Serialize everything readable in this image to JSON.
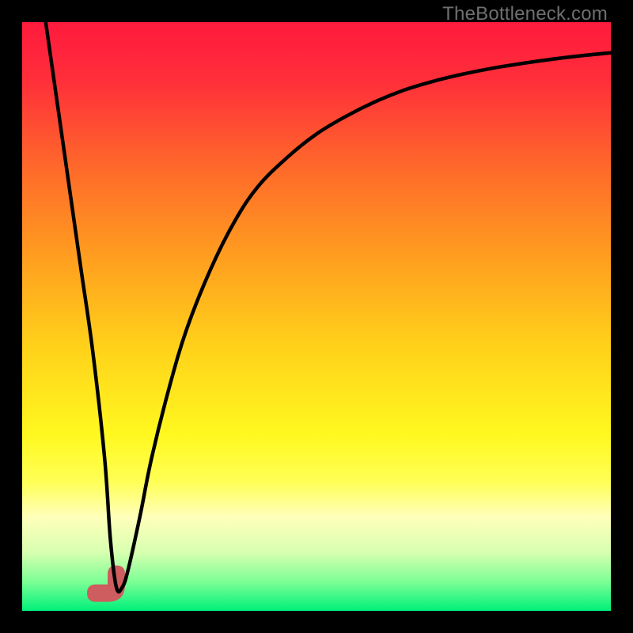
{
  "watermark": {
    "text": "TheBottleneck.com"
  },
  "colors": {
    "frame": "#000000",
    "watermark": "#6f6f6f",
    "curve": "#000000",
    "blob": "#cd5d5e",
    "gradient_stops": [
      {
        "offset": 0.0,
        "color": "#ff1a3d"
      },
      {
        "offset": 0.1,
        "color": "#ff2f3a"
      },
      {
        "offset": 0.25,
        "color": "#ff6a2a"
      },
      {
        "offset": 0.4,
        "color": "#ff9e1f"
      },
      {
        "offset": 0.55,
        "color": "#ffd11a"
      },
      {
        "offset": 0.7,
        "color": "#fff81f"
      },
      {
        "offset": 0.78,
        "color": "#ffff55"
      },
      {
        "offset": 0.84,
        "color": "#ffffba"
      },
      {
        "offset": 0.9,
        "color": "#d8ffb0"
      },
      {
        "offset": 0.95,
        "color": "#7dff96"
      },
      {
        "offset": 1.0,
        "color": "#00f07a"
      }
    ]
  },
  "chart_data": {
    "type": "line",
    "title": "",
    "xlabel": "",
    "ylabel": "",
    "xlim": [
      0,
      100
    ],
    "ylim": [
      0,
      100
    ],
    "series": [
      {
        "name": "bottleneck-curve",
        "x": [
          4,
          6,
          8,
          10,
          12,
          14,
          15,
          16,
          17,
          18,
          20,
          22,
          25,
          28,
          32,
          36,
          40,
          45,
          50,
          55,
          60,
          65,
          70,
          75,
          80,
          85,
          90,
          95,
          100
        ],
        "y": [
          100,
          86,
          72,
          58,
          44,
          26,
          12,
          4,
          4,
          7,
          16,
          26,
          38,
          48,
          58,
          66,
          72,
          77,
          81,
          84,
          86.5,
          88.5,
          90,
          91.2,
          92.2,
          93,
          93.7,
          94.3,
          94.8
        ]
      }
    ],
    "annotations": [
      {
        "name": "minimum-blob",
        "x": 16,
        "y": 3,
        "note": "rounded L-shaped marker near curve minimum"
      }
    ]
  }
}
